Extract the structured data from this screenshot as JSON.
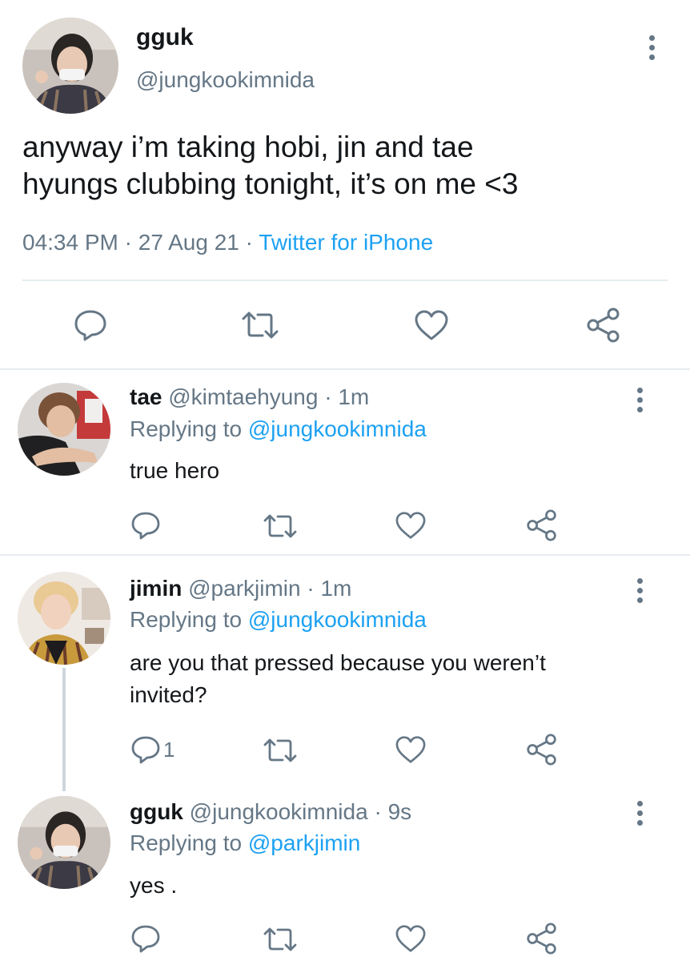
{
  "main_tweet": {
    "name": "gguk",
    "handle": "@jungkookimnida",
    "text_line1": "anyway i’m taking hobi, jin and tae",
    "text_line2": "hyungs clubbing tonight, it’s on me <3",
    "time": "04:34 PM",
    "sep1": "·",
    "date": "27 Aug 21",
    "sep2": "·",
    "source": "Twitter for iPhone"
  },
  "replies": [
    {
      "name": "tae",
      "handle": "@kimtaehyung",
      "sep": "·",
      "time": "1m",
      "replying_prefix": "Replying to",
      "replying_to": "@jungkookimnida",
      "text_line1": "true hero",
      "text_line2": "",
      "reply_count": ""
    },
    {
      "name": "jimin",
      "handle": "@parkjimin",
      "sep": "·",
      "time": "1m",
      "replying_prefix": "Replying to",
      "replying_to": "@jungkookimnida",
      "text_line1": "are you that pressed because you weren’t",
      "text_line2": "invited?",
      "reply_count": "1"
    },
    {
      "name": "gguk",
      "handle": "@jungkookimnida",
      "sep": "·",
      "time": "9s",
      "replying_prefix": "Replying to",
      "replying_to": "@parkjimin",
      "text_line1": "yes .",
      "text_line2": "",
      "reply_count": ""
    }
  ],
  "icons": {
    "reply": "reply-icon",
    "retweet": "retweet-icon",
    "like": "heart-icon",
    "share": "share-icon",
    "more": "more-options-icon"
  },
  "colors": {
    "text": "#14171a",
    "secondary": "#657786",
    "link": "#1da1f2",
    "divider": "#e6ecf0"
  }
}
